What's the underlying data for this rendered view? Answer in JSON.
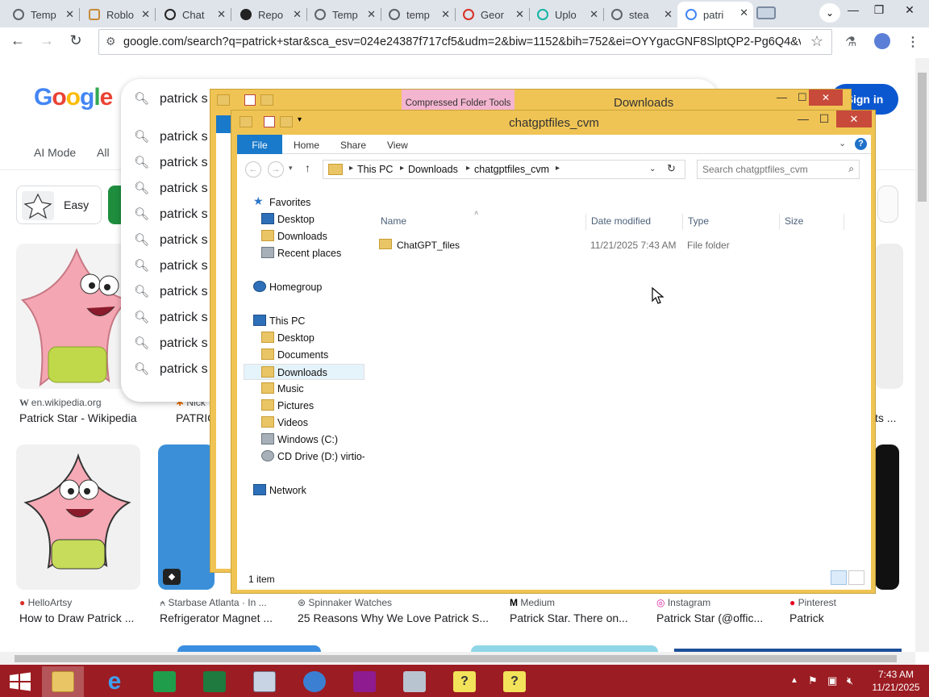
{
  "browser": {
    "tabs": [
      {
        "label": "Temp"
      },
      {
        "label": "Roblo"
      },
      {
        "label": "Chat"
      },
      {
        "label": "Repo"
      },
      {
        "label": "Temp"
      },
      {
        "label": "temp"
      },
      {
        "label": "Geor"
      },
      {
        "label": "Uplo"
      },
      {
        "label": "stea"
      },
      {
        "label": "patri",
        "active": true
      }
    ],
    "url": "google.com/search?q=patrick+star&sca_esv=024e24387f717cf5&udm=2&biw=1152&bih=752&ei=OYYgacGNF8SlptQP2-Pg6Q4&ve..."
  },
  "google": {
    "logo": [
      "G",
      "o",
      "o",
      "g",
      "l",
      "e"
    ],
    "query": "patrick s",
    "suggestions": [
      "patrick s",
      "patrick s",
      "patrick s",
      "patrick s",
      "patrick s",
      "patrick s",
      "patrick s",
      "patrick s",
      "patrick s",
      "patrick s"
    ],
    "tabs": [
      "AI Mode",
      "All"
    ],
    "sign_in": "Sign in",
    "chip_label": "Easy",
    "results_row1": [
      {
        "source": "en.wikipedia.org",
        "title": "Patrick Star - Wikipedia"
      },
      {
        "source": "Nick",
        "title": "PATRIC"
      },
      {
        "source": "",
        "title": "ts ..."
      }
    ],
    "results_row2": [
      {
        "source": "HelloArtsy",
        "title": "How to Draw Patrick ..."
      },
      {
        "source": "Starbase Atlanta · In ...",
        "title": "Refrigerator Magnet ..."
      },
      {
        "source": "Spinnaker Watches",
        "title": "25 Reasons Why We Love Patrick S..."
      },
      {
        "source": "Medium",
        "title": "Patrick Star. There on..."
      },
      {
        "source": "Instagram",
        "title": "Patrick Star (@offic..."
      },
      {
        "source": "Pinterest",
        "title": "Patrick"
      }
    ]
  },
  "bg_explorer": {
    "context_tab": "Compressed Folder Tools",
    "title": "Downloads"
  },
  "explorer": {
    "title": "chatgptfiles_cvm",
    "ribbon_tabs": [
      "File",
      "Home",
      "Share",
      "View"
    ],
    "breadcrumb": [
      "This PC",
      "Downloads",
      "chatgptfiles_cvm"
    ],
    "search_placeholder": "Search chatgptfiles_cvm",
    "nav": {
      "favorites_label": "Favorites",
      "favorites": [
        "Desktop",
        "Downloads",
        "Recent places"
      ],
      "homegroup": "Homegroup",
      "thispc_label": "This PC",
      "thispc": [
        "Desktop",
        "Documents",
        "Downloads",
        "Music",
        "Pictures",
        "Videos",
        "Windows (C:)",
        "CD Drive (D:) virtio-w"
      ],
      "network": "Network"
    },
    "columns": [
      "Name",
      "Date modified",
      "Type",
      "Size"
    ],
    "files": [
      {
        "name": "ChatGPT_files",
        "date": "11/21/2025 7:43 AM",
        "type": "File folder",
        "size": ""
      }
    ],
    "status": "1 item"
  },
  "taskbar": {
    "time": "7:43 AM",
    "date": "11/21/2025"
  }
}
